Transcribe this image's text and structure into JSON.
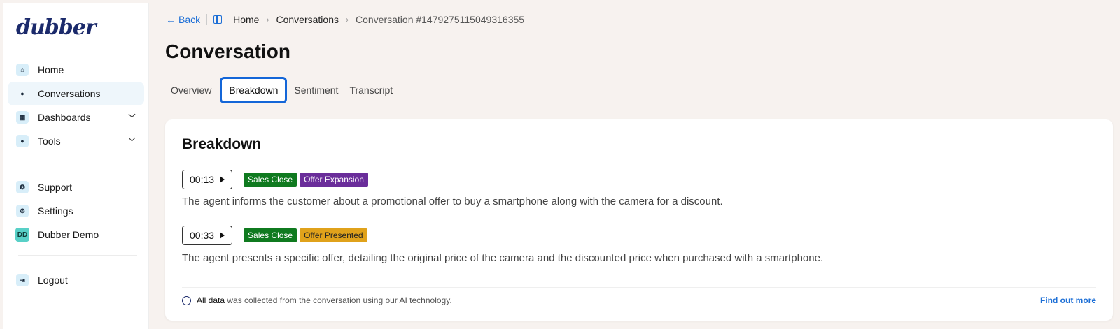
{
  "brand": {
    "logo_text": "dubber"
  },
  "sidebar": {
    "items": [
      {
        "label": "Home",
        "icon": "home-icon"
      },
      {
        "label": "Conversations",
        "icon": "chat-bubble-icon",
        "active": true
      },
      {
        "label": "Dashboards",
        "icon": "grid-icon",
        "expandable": true
      },
      {
        "label": "Tools",
        "icon": "tool-icon",
        "expandable": true
      },
      {
        "label": "Support",
        "icon": "support-icon"
      },
      {
        "label": "Settings",
        "icon": "gear-icon"
      },
      {
        "label": "Dubber Demo",
        "avatar": "DD"
      },
      {
        "label": "Logout",
        "icon": "logout-icon"
      }
    ]
  },
  "topbar": {
    "back_label": "Back",
    "breadcrumbs": [
      "Home",
      "Conversations",
      "Conversation #1479275115049316355"
    ]
  },
  "page": {
    "title": "Conversation"
  },
  "tabs": [
    {
      "label": "Overview"
    },
    {
      "label": "Breakdown",
      "active": true
    },
    {
      "label": "Sentiment"
    },
    {
      "label": "Transcript"
    }
  ],
  "breakdown": {
    "title": "Breakdown",
    "entries": [
      {
        "time": "00:13",
        "tags": [
          {
            "label": "Sales Close",
            "color": "#0f7a1f"
          },
          {
            "label": "Offer Expansion",
            "color": "#6a2d9a"
          }
        ],
        "text": "The agent informs the customer about a promotional offer to buy a smartphone along with the camera for a discount."
      },
      {
        "time": "00:33",
        "tags": [
          {
            "label": "Sales Close",
            "color": "#0f7a1f"
          },
          {
            "label": "Offer Presented",
            "color": "#e0a21b"
          }
        ],
        "text": "The agent presents a specific offer, detailing the original price of the camera and the discounted price when purchased with a smartphone."
      }
    ],
    "footer": {
      "lead": "All data",
      "text": " was collected from the conversation using our AI technology.",
      "link": "Find out more"
    }
  },
  "colors": {
    "accent": "#1d6fd6",
    "active_tab_border": "#1466d8",
    "background": "#f7f2ef"
  }
}
